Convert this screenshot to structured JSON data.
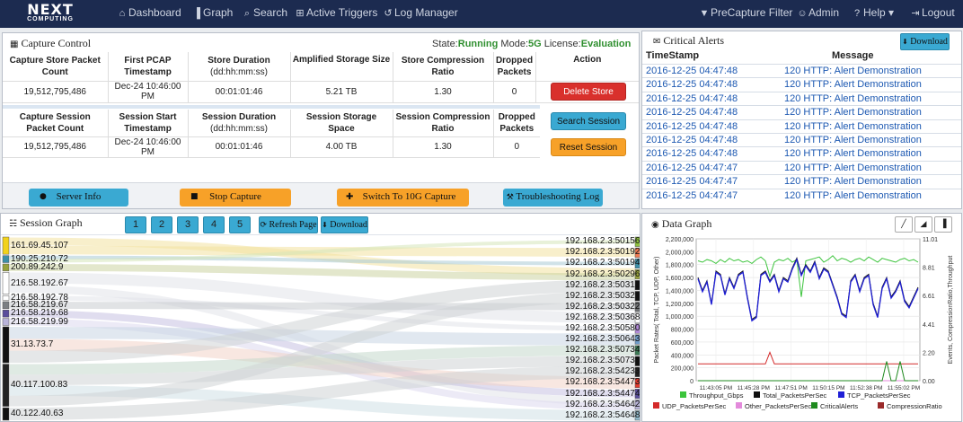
{
  "nav": {
    "logo_big": "NEXT",
    "logo_small": "COMPUTING",
    "items": [
      {
        "label": "Dashboard",
        "icon": "dashboard-icon",
        "glyph": "⌂"
      },
      {
        "label": "Graph",
        "icon": "bar-chart-icon",
        "glyph": "▐"
      },
      {
        "label": "Search",
        "icon": "search-icon",
        "glyph": "⌕"
      },
      {
        "label": "Active Triggers",
        "icon": "plus-square-icon",
        "glyph": "⊞"
      },
      {
        "label": "Log Manager",
        "icon": "history-icon",
        "glyph": "↺"
      }
    ],
    "right_items": [
      {
        "label": "PreCapture Filter",
        "icon": "filter-icon",
        "glyph": "▼"
      },
      {
        "label": "Admin",
        "icon": "users-icon",
        "glyph": "☺"
      },
      {
        "label": "Help ▾",
        "icon": "help-icon",
        "glyph": "?"
      },
      {
        "label": "Logout",
        "icon": "logout-icon",
        "glyph": "⇥"
      }
    ]
  },
  "capture": {
    "title": "Capture Control",
    "state_label": "State:",
    "state_value": "Running",
    "mode_label": "Mode:",
    "mode_value": "5G",
    "license_label": "License:",
    "license_value": "Evaluation",
    "store_headers": [
      "Capture Store Packet Count",
      "First PCAP Timestamp",
      "Store Duration",
      "Amplified Storage Size",
      "Store Compression Ratio",
      "Dropped Packets",
      "Action"
    ],
    "store_duration_unit": "(dd:hh:mm:ss)",
    "store_values": [
      "19,512,795,486",
      "Dec-24 10:46:00 PM",
      "00:01:01:46",
      "5.21 TB",
      "1.30",
      "0"
    ],
    "delete_store": "Delete Store",
    "session_headers": [
      "Capture Session Packet Count",
      "Session Start Timestamp",
      "Session Duration",
      "Session Storage Space",
      "Session Compression Ratio",
      "Dropped Packets"
    ],
    "session_duration_unit": "(dd:hh:mm:ss)",
    "session_values": [
      "19,512,795,486",
      "Dec-24 10:46:00 PM",
      "00:01:01:46",
      "4.00 TB",
      "1.30",
      "0"
    ],
    "search_session": "Search Session",
    "reset_session": "Reset Session",
    "server_info": "Server Info",
    "stop_capture": "Stop Capture",
    "switch_capture": "Switch To 10G Capture",
    "troubleshooting": "Troubleshooting Log"
  },
  "alerts": {
    "title": "Critical Alerts",
    "download": "Download",
    "col_time": "TimeStamp",
    "col_msg": "Message",
    "rows": [
      {
        "time": "2016-12-25 04:47:48",
        "msg": "120 HTTP: Alert Demonstration"
      },
      {
        "time": "2016-12-25 04:47:48",
        "msg": "120 HTTP: Alert Demonstration"
      },
      {
        "time": "2016-12-25 04:47:48",
        "msg": "120 HTTP: Alert Demonstration"
      },
      {
        "time": "2016-12-25 04:47:48",
        "msg": "120 HTTP: Alert Demonstration"
      },
      {
        "time": "2016-12-25 04:47:48",
        "msg": "120 HTTP: Alert Demonstration"
      },
      {
        "time": "2016-12-25 04:47:48",
        "msg": "120 HTTP: Alert Demonstration"
      },
      {
        "time": "2016-12-25 04:47:48",
        "msg": "120 HTTP: Alert Demonstration"
      },
      {
        "time": "2016-12-25 04:47:47",
        "msg": "120 HTTP: Alert Demonstration"
      },
      {
        "time": "2016-12-25 04:47:47",
        "msg": "120 HTTP: Alert Demonstration"
      },
      {
        "time": "2016-12-25 04:47:47",
        "msg": "120 HTTP: Alert Demonstration"
      }
    ]
  },
  "session_graph": {
    "title": "Session Graph",
    "pages": [
      "1",
      "2",
      "3",
      "4",
      "5"
    ],
    "refresh": "Refresh Page",
    "download": "Download",
    "left_nodes": [
      {
        "label": "161.69.45.107",
        "color": "#f2d21b",
        "weight": 1.1
      },
      {
        "label": "190.25.210.72",
        "color": "#3d8fa8",
        "weight": 0.45
      },
      {
        "label": "200.89.242.9",
        "color": "#98a23c",
        "weight": 0.45
      },
      {
        "label": "216.58.192.67",
        "color": "#ffffff",
        "weight": 1.4
      },
      {
        "label": "216.58.192.78",
        "color": "#ffffff",
        "weight": 0.3
      },
      {
        "label": "216.58.219.67",
        "color": "#7b7f83",
        "weight": 0.45
      },
      {
        "label": "216.58.219.68",
        "color": "#5b4e9c",
        "weight": 0.45
      },
      {
        "label": "216.58.219.99",
        "color": "#b9b4d9",
        "weight": 0.45
      },
      {
        "label": "31.13.73.7",
        "color": "#111111",
        "weight": 2.3
      },
      {
        "label": "40.117.100.83",
        "color": "#222222",
        "weight": 2.7
      },
      {
        "label": "40.122.40.63",
        "color": "#111111",
        "weight": 0.8
      }
    ],
    "right_nodes": [
      {
        "label": "192.168.2.3:50156",
        "color": "#8fc13e"
      },
      {
        "label": "192.168.2.3:50192",
        "color": "#f07b52"
      },
      {
        "label": "192.168.2.3:50194",
        "color": "#3d8fa8"
      },
      {
        "label": "192.168.2.3:50296",
        "color": "#98a23c"
      },
      {
        "label": "192.168.2.3:50318",
        "color": "#111111"
      },
      {
        "label": "192.168.2.3:50321",
        "color": "#111111"
      },
      {
        "label": "192.168.2.3:50322",
        "color": "#6e7072"
      },
      {
        "label": "192.168.2.3:50368",
        "color": "#ffffff"
      },
      {
        "label": "192.168.2.3:50580",
        "color": "#b089d6"
      },
      {
        "label": "192.168.2.3:50643",
        "color": "#6f9cc9"
      },
      {
        "label": "192.168.2.3:50734",
        "color": "#3c7a55"
      },
      {
        "label": "192.168.2.3:50735",
        "color": "#111111"
      },
      {
        "label": "192.168.2.3:54233",
        "color": "#222222"
      },
      {
        "label": "192.168.2.3:54473",
        "color": "#e23a2e"
      },
      {
        "label": "192.168.2.3:54474",
        "color": "#5b4e9c"
      },
      {
        "label": "192.168.2.3:54642",
        "color": "#b9b4d9"
      },
      {
        "label": "192.168.2.3:54648",
        "color": "#8fb8c9"
      }
    ],
    "links": [
      {
        "from": 0,
        "to": 3,
        "color": "#f3e2a0"
      },
      {
        "from": 0,
        "to": 1,
        "color": "#f3e2a0"
      },
      {
        "from": 1,
        "to": 2,
        "color": "#a9cad6"
      },
      {
        "from": 2,
        "to": 3,
        "color": "#ccd3a3"
      },
      {
        "from": 3,
        "to": 7,
        "color": "#e2e4ea"
      },
      {
        "from": 3,
        "to": 15,
        "color": "#e2e4ea"
      },
      {
        "from": 4,
        "to": 8,
        "color": "#e2e4ea"
      },
      {
        "from": 5,
        "to": 6,
        "color": "#c9ccd0"
      },
      {
        "from": 6,
        "to": 14,
        "color": "#c6c1e1"
      },
      {
        "from": 7,
        "to": 15,
        "color": "#dcd9ef"
      },
      {
        "from": 8,
        "to": 9,
        "color": "#c8d6e4"
      },
      {
        "from": 8,
        "to": 13,
        "color": "#f3d3c8"
      },
      {
        "from": 9,
        "to": 10,
        "color": "#c4d8cc"
      },
      {
        "from": 9,
        "to": 11,
        "color": "#d0d3d6"
      },
      {
        "from": 9,
        "to": 16,
        "color": "#cfe0e6"
      },
      {
        "from": 10,
        "to": 12,
        "color": "#d0d3d6"
      },
      {
        "from": 1,
        "to": 0,
        "color": "#d6e6b9"
      },
      {
        "from": 8,
        "to": 4,
        "color": "#d0d3d6"
      },
      {
        "from": 9,
        "to": 5,
        "color": "#d0d3d6"
      }
    ]
  },
  "data_graph": {
    "title": "Data Graph",
    "tool_icons": [
      "line-chart-icon",
      "area-chart-icon",
      "bar-chart-icon"
    ],
    "chart_data": {
      "type": "line",
      "ylabel": "Packet Rates( Total, TCP, UDP, Other)",
      "y2label": "Events, CompressionRatio,Throughput",
      "ylim": [
        0,
        2200000
      ],
      "y2lim": [
        0,
        11.01
      ],
      "yticks": [
        "0",
        "200,000",
        "400,000",
        "600,000",
        "800,000",
        "1,000,000",
        "1,200,000",
        "1,400,000",
        "1,600,000",
        "1,800,000",
        "2,000,000",
        "2,200,000"
      ],
      "y2ticks": [
        "0.00",
        "2.20",
        "4.41",
        "6.61",
        "8.81",
        "11.01"
      ],
      "xticks": [
        "11:43:05 PM",
        "11:45:28 PM",
        "11:47:51 PM",
        "11:50:15 PM",
        "11:52:38 PM",
        "11:55:02 PM"
      ],
      "grid": true,
      "legend_position": "bottom",
      "series": [
        {
          "name": "Throughput_Gbps",
          "color": "#3cc43c",
          "axis": "y2",
          "values": [
            9.3,
            9.2,
            9.4,
            9.3,
            9.1,
            9.4,
            9.2,
            9.5,
            9.3,
            9.4,
            9.2,
            9.3,
            9.1,
            9.4,
            9.6,
            9.3,
            8.1,
            9.2,
            9.4,
            9.3,
            9.5,
            9.2,
            9.4,
            6.5,
            9.3,
            9.4,
            9.5,
            9.6,
            9.2,
            9.4,
            9.7,
            9.3,
            9.5,
            9.4,
            9.2,
            9.4,
            9.5,
            9.3,
            9.6,
            9.4,
            9.2,
            9.5,
            9.4,
            9.3,
            9.2,
            9.4,
            9.5,
            9.3,
            9.4,
            9.2
          ]
        },
        {
          "name": "Total_PacketsPerSec",
          "color": "#111111",
          "axis": "y",
          "values": [
            1600000,
            1400000,
            1550000,
            1200000,
            1700000,
            1650000,
            1350000,
            1600000,
            1450000,
            1650000,
            1700000,
            1300000,
            950000,
            1000000,
            1650000,
            1700000,
            1550000,
            1650000,
            1400000,
            1600000,
            1550000,
            1750000,
            1900000,
            1650000,
            1800000,
            1700000,
            1850000,
            1600000,
            1750000,
            1700000,
            1500000,
            1300000,
            1050000,
            1000000,
            1550000,
            1650000,
            1400000,
            1600000,
            1650000,
            1200000,
            1000000,
            1450000,
            1600000,
            1300000,
            1400000,
            1550000,
            1250000,
            1150000,
            1300000,
            1450000
          ]
        },
        {
          "name": "TCP_PacketsPerSec",
          "color": "#1f1fd6",
          "axis": "y",
          "values": [
            1580000,
            1380000,
            1530000,
            1180000,
            1680000,
            1630000,
            1330000,
            1580000,
            1430000,
            1630000,
            1680000,
            1280000,
            930000,
            980000,
            1630000,
            1680000,
            1530000,
            1630000,
            1380000,
            1580000,
            1530000,
            1730000,
            1880000,
            1630000,
            1780000,
            1680000,
            1830000,
            1580000,
            1730000,
            1680000,
            1480000,
            1280000,
            1030000,
            980000,
            1530000,
            1630000,
            1380000,
            1580000,
            1630000,
            1180000,
            980000,
            1430000,
            1580000,
            1280000,
            1380000,
            1530000,
            1230000,
            1130000,
            1280000,
            1430000
          ]
        },
        {
          "name": "UDP_PacketsPerSec",
          "color": "#d42a2a",
          "axis": "y",
          "values": [
            260000,
            260000,
            260000,
            260000,
            260000,
            260000,
            260000,
            260000,
            260000,
            260000,
            260000,
            260000,
            260000,
            260000,
            260000,
            260000,
            260000,
            260000,
            260000,
            260000,
            260000,
            260000,
            260000,
            260000,
            260000,
            260000,
            260000,
            260000,
            260000,
            260000,
            260000,
            260000,
            260000,
            260000,
            260000,
            260000,
            260000,
            260000,
            260000,
            260000,
            260000,
            260000,
            260000,
            260000,
            260000,
            260000,
            260000,
            260000,
            260000,
            260000
          ]
        },
        {
          "name": "Other_PacketsPerSec",
          "color": "#e38adb",
          "axis": "y",
          "values": [
            0,
            0,
            0,
            0,
            0,
            0,
            0,
            0,
            0,
            0,
            0,
            0,
            0,
            0,
            0,
            0,
            0,
            0,
            0,
            0,
            0,
            0,
            0,
            0,
            0,
            0,
            0,
            0,
            0,
            0,
            0,
            0,
            0,
            0,
            0,
            0,
            0,
            0,
            0,
            0,
            0,
            0,
            0,
            0,
            0,
            0,
            0,
            0,
            0,
            0
          ]
        },
        {
          "name": "CriticalAlerts",
          "color": "#1f8a1f",
          "axis": "y2",
          "values": [
            0,
            0,
            0,
            0,
            0,
            0,
            0,
            0,
            0,
            0,
            0,
            0,
            0,
            0,
            0,
            0,
            0,
            0,
            0,
            0,
            0,
            0,
            0,
            0,
            0,
            0,
            0,
            0,
            0,
            0,
            0,
            0,
            0,
            0,
            0,
            0,
            0,
            0,
            0,
            0,
            0,
            0,
            1.5,
            0,
            0,
            1.5,
            0,
            0,
            0,
            0
          ]
        },
        {
          "name": "CompressionRatio",
          "color": "#9a2a2a",
          "axis": "y2",
          "values": [
            0,
            0,
            0,
            0,
            0,
            0,
            0,
            0,
            0,
            0,
            0,
            0,
            0,
            0,
            0,
            0,
            0,
            0,
            0,
            0,
            0,
            0,
            0,
            0,
            0,
            0,
            0,
            0,
            0,
            0,
            0,
            0,
            0,
            0,
            0,
            0,
            0,
            0,
            0,
            0,
            0,
            0,
            0,
            0,
            0,
            0,
            0,
            0,
            0,
            0
          ]
        }
      ],
      "extra_spike": {
        "series": "UDP_PacketsPerSec",
        "at_index": 16,
        "value": 180000
      }
    }
  }
}
